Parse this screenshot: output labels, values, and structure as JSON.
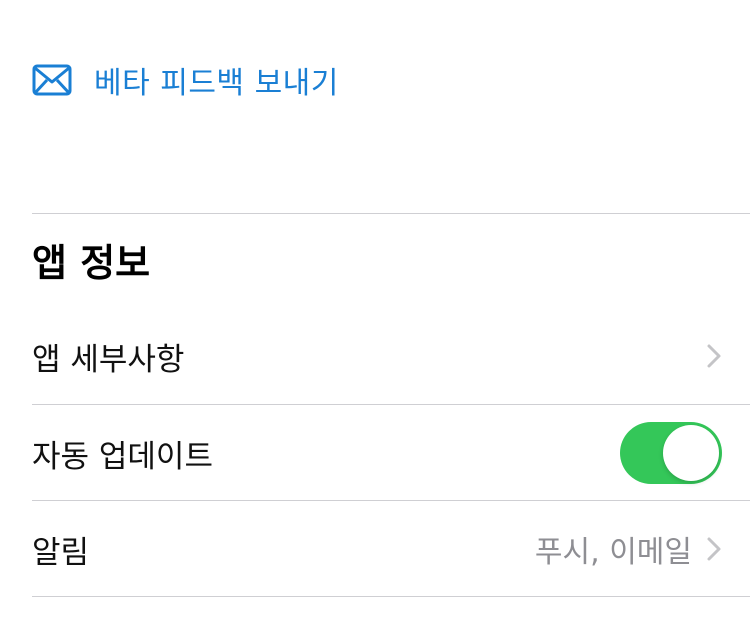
{
  "feedback": {
    "label": "베타 피드백 보내기",
    "icon": "envelope-icon"
  },
  "section": {
    "title": "앱 정보"
  },
  "rows": [
    {
      "label": "앱 세부사항",
      "control": "chevron"
    },
    {
      "label": "자동 업데이트",
      "control": "toggle",
      "toggle_on": true
    },
    {
      "label": "알림",
      "value": "푸시, 이메일",
      "control": "chevron"
    }
  ],
  "colors": {
    "link_blue": "#1a7fd4",
    "toggle_on": "#34c759",
    "secondary_text": "#8e8e93",
    "chevron": "#c4c4c7",
    "divider": "#cfcfd3"
  }
}
